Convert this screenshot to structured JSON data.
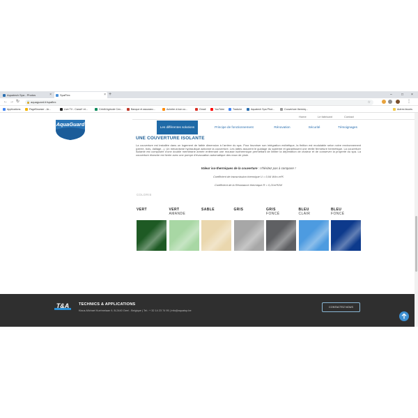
{
  "browser": {
    "tabs": [
      {
        "title": "Aquatech Spa - Photos"
      },
      {
        "title": "SpaFlex"
      }
    ],
    "new_tab": "+",
    "url": "aquaguard.fr/spaflex",
    "bookmarks": [
      "Applications",
      "PageBrowser - Ar...",
      "Live TV - Canal+ et...",
      "Crédit Agricole Cen...",
      "Banque et assuranc...",
      "Acheter à bon co...",
      "Gmail",
      "YouTube",
      "Traduire",
      "Aquatech Spa Phot...",
      "Couverture thermiq..."
    ],
    "other_bookmarks": "Autres favoris"
  },
  "site": {
    "logo_text": "AquaGuard",
    "top_links": [
      "Home",
      "Le fabricant",
      "Contact"
    ],
    "nav": [
      {
        "label": "Les différentes solutions",
        "active": true
      },
      {
        "label": "Principe de fonctionnement",
        "active": false
      },
      {
        "label": "Rénovation",
        "active": false
      },
      {
        "label": "Sécurité",
        "active": false
      },
      {
        "label": "Témoignages",
        "active": false
      }
    ],
    "heading": "UNE COUVERTURE ISOLANTE",
    "paragraph": "La couverture est installée dans un logement de faible dimension à l'arrière du spa. Pour favoriser son intégration esthétique, la finition est modulable selon votre environnement (pierre, bois, dallage...). Un mécanisme hydraulique actionne la couverture. Les lattes assurent le guidage du système et garantissent une réelle fermeture hermétique. La couverture isolante est composée d'une double membrane armée enfermant une mousse isothermique permettant de limiter la déperdition de chaleur et de conserver la propreté du spa. La couverture étanche est livrée avec une pompe d'évacuation automatique des eaux de pluie.",
    "thermal": {
      "title_bold": "Valeur iso-thermiques de la couverture",
      "title_rest": " : n'hésitez pas à comparer !",
      "line1": "Coefficient de transmission thermique U = 0,94 W/m.m²K",
      "line2": "Coefficient de la Résistance thermique R = 0,21m²K/W"
    },
    "colors_label": "COLORIS",
    "colors": [
      {
        "name": "VERT",
        "sub": "",
        "hex": "#1e5a24"
      },
      {
        "name": "VERT",
        "sub": "AMANDE",
        "hex": "#a8d7a4"
      },
      {
        "name": "SABLE",
        "sub": "",
        "hex": "#ead7ae"
      },
      {
        "name": "GRIS",
        "sub": "",
        "hex": "#a7a7a7"
      },
      {
        "name": "GRIS",
        "sub": "FONCÉ",
        "hex": "#5f6063"
      },
      {
        "name": "BLEU",
        "sub": "CLAIR",
        "hex": "#4d9be0"
      },
      {
        "name": "BLEU",
        "sub": "FONCÉ",
        "hex": "#0d3a8c"
      }
    ]
  },
  "footer": {
    "logo_text": "T&A",
    "company": "TECHNICS & APPLICATIONS",
    "address": "Klaus-Michael Kuehnelaan 9, B-2440 Geel - Belgique  |  Tel.: + 32 14 23 74 95  |  info@aquatop.be",
    "contact_button": "CONTACTEZ NOUS",
    "back_to_top": "↑"
  },
  "colors": {
    "accent": "#1f6aa7",
    "footer_bg": "#2f2f2f",
    "heading": "#1f5f95"
  }
}
